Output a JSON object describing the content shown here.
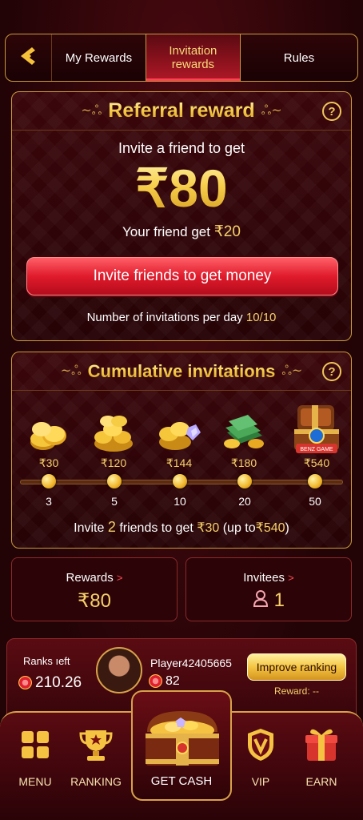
{
  "tabs": {
    "back_icon": "chevron-left-icon",
    "items": [
      {
        "label": "My Rewards"
      },
      {
        "label": "Invitation rewards"
      },
      {
        "label": "Rules"
      }
    ]
  },
  "referral": {
    "title": "Referral reward",
    "line1": "Invite a friend to get",
    "amount": "₹80",
    "friend_label": "Your friend get",
    "friend_amount": "₹20",
    "button_label": "Invite friends to get money",
    "per_day_label": "Number of invitations per day",
    "per_day_value": "10/10"
  },
  "cumulative": {
    "title": "Cumulative invitations",
    "rewards": [
      {
        "value": "₹30",
        "step": "3",
        "icon": "coins-icon"
      },
      {
        "value": "₹120",
        "step": "5",
        "icon": "coin-pile-icon"
      },
      {
        "value": "₹144",
        "step": "10",
        "icon": "coins-gems-icon"
      },
      {
        "value": "₹180",
        "step": "20",
        "icon": "cash-stack-icon"
      },
      {
        "value": "₹540",
        "step": "50",
        "icon": "treasure-chest-icon"
      }
    ],
    "summary_pre": "Invite",
    "summary_count": "2",
    "summary_mid": "friends to get",
    "summary_amount": "₹30",
    "summary_post": "(up to",
    "summary_max": "₹540",
    "summary_close": ")",
    "badge_text": "BENZ GAME"
  },
  "stats": {
    "rewards_label": "Rewards",
    "rewards_value": "₹80",
    "invitees_label": "Invitees",
    "invitees_value": "1"
  },
  "rank": {
    "ranks_label": "Ranks ıeft",
    "ranks_value": "210.26",
    "player_name": "Player42405665",
    "player_value": "82",
    "improve_label": "Improve ranking",
    "reward_label": "Reward: --"
  },
  "nav": {
    "menu": "MENU",
    "ranking": "RANKING",
    "cash": "GET CASH",
    "vip": "VIP",
    "earn": "EARN"
  }
}
